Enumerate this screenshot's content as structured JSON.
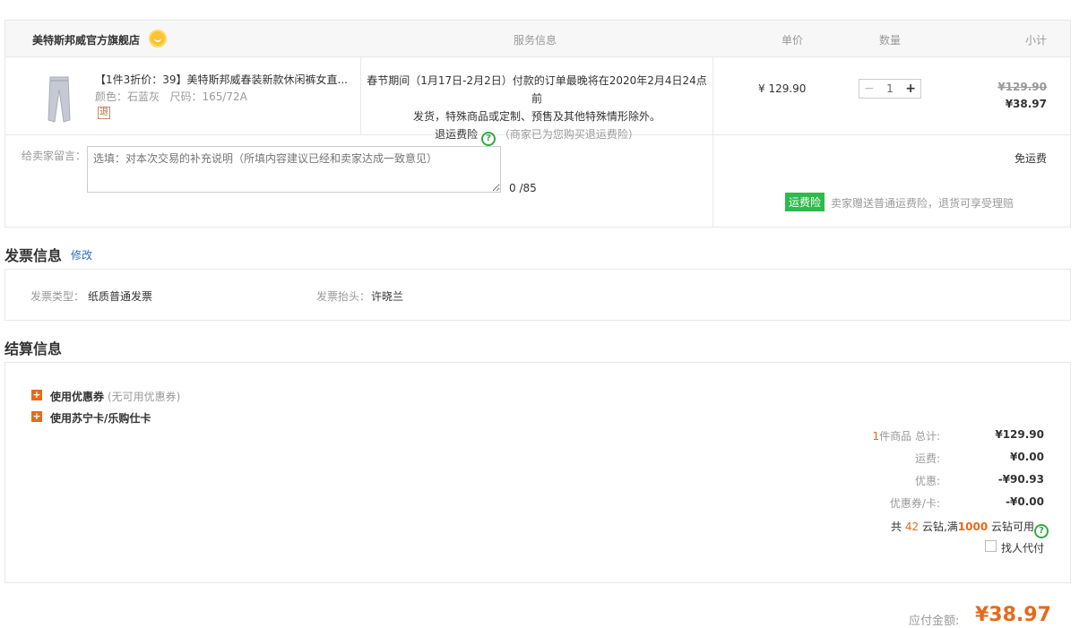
{
  "order": {
    "header": {
      "shop_name": "美特斯邦威官方旗舰店",
      "col_service": "服务信息",
      "col_unit_price": "单价",
      "col_quantity": "数量",
      "col_subtotal": "小计"
    },
    "item": {
      "title": "【1件3折价：39】美特斯邦威春装新款休闲裤女直...",
      "spec": "颜色：石蓝灰   尺码：165/72A",
      "return_tag": "退",
      "service_line1": "春节期间（1月17日-2月2日）付款的订单最晚将在2020年2月4日24点前",
      "service_line2": "发货，特殊商品或定制、预售及其他特殊情形除外。",
      "service_insurance": "退运费险",
      "service_insurance_note": "（商家已为您购买退运费险）",
      "unit_price": "¥ 129.90",
      "quantity": "1",
      "old_subtotal": "¥129.90",
      "new_subtotal": "¥38.97"
    },
    "message": {
      "label": "给卖家留言：",
      "placeholder": "选填：对本次交易的补充说明（所填内容建议已经和卖家达成一致意见）",
      "count": "0 /85"
    },
    "shipping": {
      "free_shipping": "免运费",
      "insurance_badge": "运费险",
      "insurance_text": "卖家赠送普通运费险，退货可享受理赔"
    }
  },
  "invoice": {
    "title": "发票信息",
    "modify": "修改",
    "type_label": "发票类型：",
    "type_value": "纸质普通发票",
    "header_label": "发票抬头：",
    "header_value": "许晓兰"
  },
  "settlement": {
    "title": "结算信息",
    "coupon_label": "使用优惠券",
    "coupon_note": "(无可用优惠券)",
    "card_label": "使用苏宁卡/乐购仕卡",
    "items_count": "1",
    "items_label": "件商品 总计:",
    "total": "¥129.90",
    "freight_label": "运费:",
    "freight": "¥0.00",
    "discount_label": "优惠:",
    "discount": "-¥90.93",
    "coupon_card_label": "优惠券/卡:",
    "coupon_card": "-¥0.00",
    "diamond_prefix": "共",
    "diamond_count": "42",
    "diamond_mid": "云钻,满",
    "diamond_threshold": "1000",
    "diamond_suffix": "云钻可用",
    "proxy_pay": "找人代付",
    "pay_label": "应付金额:",
    "pay_total": "¥38.97"
  },
  "icons": {
    "shop_badge": "smile-badge-icon",
    "help": "question-circle-icon",
    "plus": "plus-square-icon"
  },
  "colors": {
    "accent_orange": "#e66a1a",
    "insurance_green": "#2dbb4c",
    "link_blue": "#2b6cc4"
  }
}
